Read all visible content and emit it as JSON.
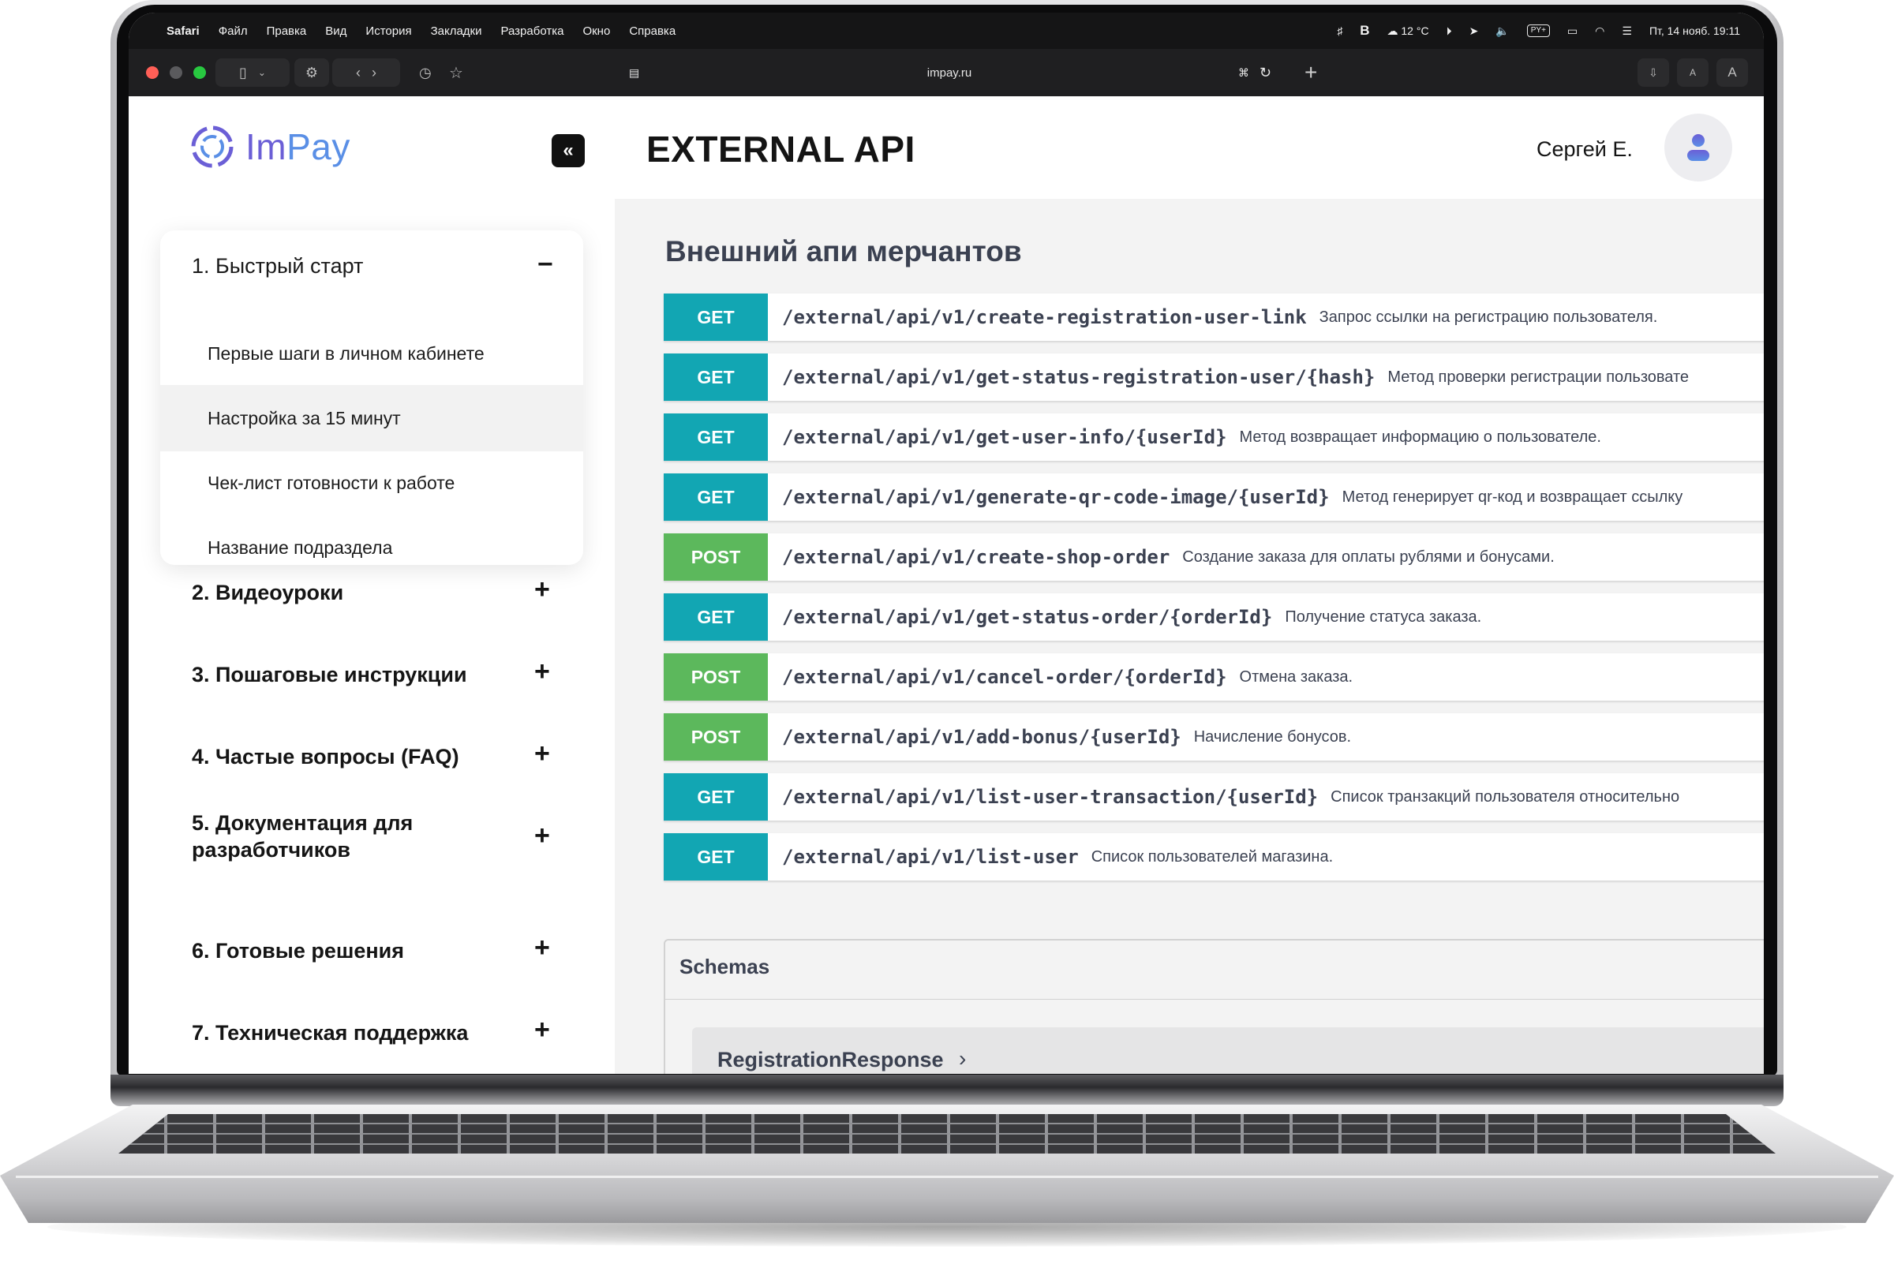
{
  "menubar": {
    "app_name": "Safari",
    "menus": [
      "Файл",
      "Правка",
      "Вид",
      "История",
      "Закладки",
      "Разработка",
      "Окно",
      "Справка"
    ],
    "weather": "12 °C",
    "datetime": "Пт, 14 нояб.  19:11",
    "tray_badge_1": "PY+",
    "bold_b": "B"
  },
  "browser": {
    "url": "impay.ru",
    "reader_a_small": "A",
    "reader_a_large": "A"
  },
  "sidebar": {
    "logo_im": "Im",
    "logo_pay": "Pay",
    "collapse_icon": "«",
    "open_section": {
      "label": "1. Быстрый старт",
      "items": [
        {
          "label": "Первые шаги в личном кабинете",
          "active": false
        },
        {
          "label": "Настройка за 15 минут",
          "active": true
        },
        {
          "label": "Чек-лист готовности к работе",
          "active": false
        },
        {
          "label": "Название подраздела",
          "active": false
        }
      ]
    },
    "sections": [
      {
        "label": "2. Видеоуроки"
      },
      {
        "label": "3. Пошаговые инструкции"
      },
      {
        "label": "4. Частые вопросы (FAQ)"
      },
      {
        "label": "5. Документация для разработчиков"
      },
      {
        "label": "6. Готовые решения"
      },
      {
        "label": "7. Техническая поддержка"
      }
    ]
  },
  "header": {
    "title": "EXTERNAL API",
    "user_name": "Сергей Е."
  },
  "api": {
    "section_title": "Внешний апи мерчантов",
    "colors": {
      "GET": "#12a6b3",
      "POST": "#5cb85c"
    },
    "endpoints": [
      {
        "method": "GET",
        "path": "/external/api/v1/create-registration-user-link",
        "desc": "Запрос ссылки на регистрацию пользователя."
      },
      {
        "method": "GET",
        "path": "/external/api/v1/get-status-registration-user/{hash}",
        "desc": "Метод проверки регистрации пользовате"
      },
      {
        "method": "GET",
        "path": "/external/api/v1/get-user-info/{userId}",
        "desc": "Метод возвращает информацию о пользователе."
      },
      {
        "method": "GET",
        "path": "/external/api/v1/generate-qr-code-image/{userId}",
        "desc": "Метод генерирует qr-код и возвращает ссылку"
      },
      {
        "method": "POST",
        "path": "/external/api/v1/create-shop-order",
        "desc": "Создание заказа для оплаты рублями и бонусами."
      },
      {
        "method": "GET",
        "path": "/external/api/v1/get-status-order/{orderId}",
        "desc": "Получение статуса заказа."
      },
      {
        "method": "POST",
        "path": "/external/api/v1/cancel-order/{orderId}",
        "desc": "Отмена заказа."
      },
      {
        "method": "POST",
        "path": "/external/api/v1/add-bonus/{userId}",
        "desc": "Начисление бонусов."
      },
      {
        "method": "GET",
        "path": "/external/api/v1/list-user-transaction/{userId}",
        "desc": "Список транзакций пользователя относительно"
      },
      {
        "method": "GET",
        "path": "/external/api/v1/list-user",
        "desc": "Список пользователей магазина."
      }
    ],
    "schemas_title": "Schemas",
    "schema_first": "RegistrationResponse"
  }
}
